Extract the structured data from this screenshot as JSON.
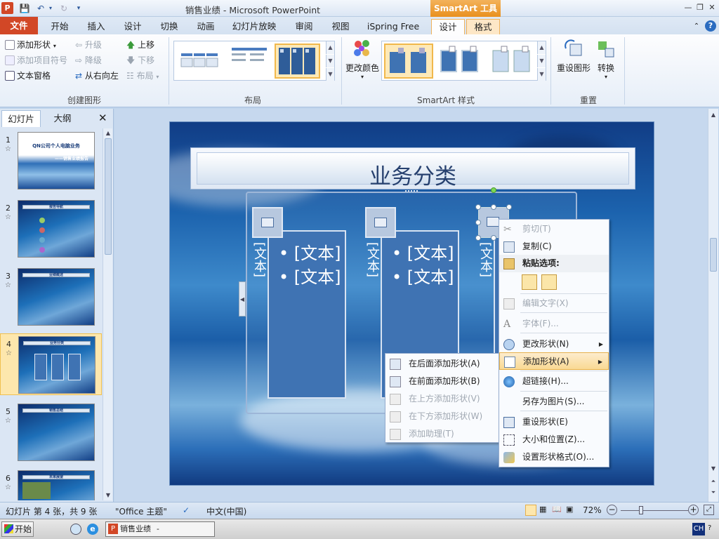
{
  "window": {
    "title": "销售业绩 - Microsoft PowerPoint",
    "context_tab": "SmartArt 工具",
    "app_icon": "P"
  },
  "ribbon_tabs": [
    {
      "label": "文件"
    },
    {
      "label": "开始"
    },
    {
      "label": "插入"
    },
    {
      "label": "设计"
    },
    {
      "label": "切换"
    },
    {
      "label": "动画"
    },
    {
      "label": "幻灯片放映"
    },
    {
      "label": "审阅"
    },
    {
      "label": "视图"
    },
    {
      "label": "iSpring Free"
    },
    {
      "label": "设计"
    },
    {
      "label": "格式"
    }
  ],
  "ribbon": {
    "create_graphic": {
      "label": "创建图形",
      "add_shape": "添加形状",
      "add_bullet": "添加项目符号",
      "text_pane": "文本窗格",
      "promote": "升级",
      "demote": "降级",
      "right_to_left": "从右向左",
      "move_up": "上移",
      "move_down": "下移",
      "layout": "布局"
    },
    "layouts": {
      "label": "布局"
    },
    "styles": {
      "label": "SmartArt 样式",
      "change_colors": "更改颜色"
    },
    "reset": {
      "label": "重置",
      "reset_graphic": "重设图形",
      "convert": "转换"
    }
  },
  "left_pane": {
    "tabs": [
      "幻灯片",
      "大纲"
    ],
    "slides": [
      {
        "num": "1",
        "title": "QN公司个人电脑业务",
        "subtitle": "——销售业绩报告"
      },
      {
        "num": "2",
        "title": "报告导航"
      },
      {
        "num": "3",
        "title": "业绩概述"
      },
      {
        "num": "4",
        "title": "业务分类"
      },
      {
        "num": "5",
        "title": "销售总结"
      },
      {
        "num": "6",
        "title": "未来展望"
      }
    ]
  },
  "slide": {
    "title": "业务分类",
    "columns": [
      {
        "vertical": "[文本]",
        "bullets": [
          "[文本]",
          "[文本]"
        ]
      },
      {
        "vertical": "[文本]",
        "bullets": [
          "[文本]",
          "[文本]"
        ]
      },
      {
        "vertical": "[文本]",
        "bullets": []
      }
    ]
  },
  "context_menu": {
    "items": [
      {
        "label": "剪切(T)",
        "enabled": false
      },
      {
        "label": "复制(C)",
        "enabled": true
      },
      {
        "label": "粘贴选项:",
        "enabled": true
      },
      {
        "label": "编辑文字(X)",
        "enabled": false
      },
      {
        "label": "字体(F)...",
        "enabled": false
      },
      {
        "label": "更改形状(N)",
        "enabled": true
      },
      {
        "label": "添加形状(A)",
        "enabled": true
      },
      {
        "label": "超链接(H)...",
        "enabled": true
      },
      {
        "label": "另存为图片(S)...",
        "enabled": true
      },
      {
        "label": "重设形状(E)",
        "enabled": true
      },
      {
        "label": "大小和位置(Z)...",
        "enabled": true
      },
      {
        "label": "设置形状格式(O)...",
        "enabled": true
      }
    ]
  },
  "submenu": {
    "items": [
      {
        "label": "在后面添加形状(A)",
        "enabled": true
      },
      {
        "label": "在前面添加形状(B)",
        "enabled": true
      },
      {
        "label": "在上方添加形状(V)",
        "enabled": false
      },
      {
        "label": "在下方添加形状(W)",
        "enabled": false
      },
      {
        "label": "添加助理(T)",
        "enabled": false
      }
    ]
  },
  "status": {
    "slide_info": "幻灯片 第 4 张，共 9 张",
    "theme": "\"Office 主题\"",
    "language": "中文(中国)",
    "zoom": "72%"
  },
  "taskbar": {
    "start": "开始",
    "task": "销售业绩 - Microsof...",
    "ime": "CH"
  }
}
